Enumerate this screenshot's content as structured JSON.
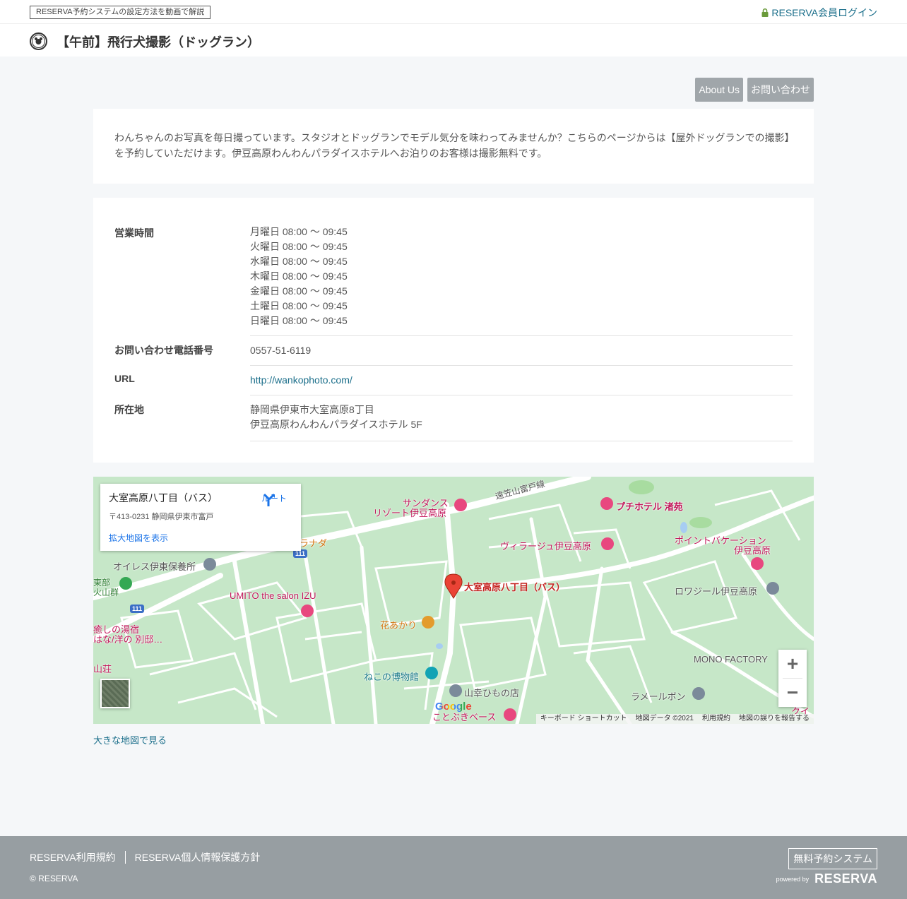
{
  "topbar": {
    "video_link": "RESERVA予約システムの設定方法を動画で解説",
    "login_link": "RESERVA会員ログイン"
  },
  "header": {
    "title": "【午前】飛行犬撮影（ドッグラン）"
  },
  "tabs": [
    {
      "label": "About Us"
    },
    {
      "label": "お問い合わせ"
    }
  ],
  "description": "わんちゃんのお写真を毎日撮っています。スタジオとドッグランでモデル気分を味わってみませんか？こちらのページからは【屋外ドッグランでの撮影】を予約していただけます。伊豆高原わんわんパラダイスホテルへお泊りのお客様は撮影無料です。",
  "info": {
    "hours_label": "営業時間",
    "hours": [
      "月曜日 08:00 ～ 09:45",
      "火曜日 08:00 ～ 09:45",
      "水曜日 08:00 ～ 09:45",
      "木曜日 08:00 ～ 09:45",
      "金曜日 08:00 ～ 09:45",
      "土曜日 08:00 ～ 09:45",
      "日曜日 08:00 ～ 09:45"
    ],
    "phone_label": "お問い合わせ電話番号",
    "phone": "0557-51-6119",
    "url_label": "URL",
    "url": "http://wankophoto.com/",
    "address_label": "所在地",
    "address_line1": "静岡県伊東市大室高原8丁目",
    "address_line2": "伊豆高原わんわんパラダイスホテル 5F"
  },
  "map": {
    "info_title": "大室高原八丁目（バス）",
    "info_address": "〒413-0231 静岡県伊東市富戸",
    "info_link": "拡大地図を表示",
    "route_label": "ルート",
    "labels": {
      "sundance": "サンダンス",
      "sundance2": "リゾート伊豆高原",
      "toasayama": "遠笠山富戸線",
      "petit_hotel": "プチホテル 渚苑",
      "granada": "ラナダ",
      "village": "ヴィラージュ伊豆高原",
      "point_vacation": "ポイントバケーション",
      "point_vacation2": "伊豆高原",
      "oires": "オイレス伊東保養所",
      "higashibu": "東部",
      "kazan": "火山群",
      "pin": "大室高原八丁目（バス）",
      "rowazil": "ロワジール伊豆高原",
      "umito": "UMITO the salon IZU",
      "hanaakari": "花あかり",
      "iyashi": "癒しの湯宿",
      "hana_besso": "はな/洋の 別邸…",
      "sanso": "山荘",
      "mono_factory": "MONO FACTORY",
      "neko": "ねこの博物館",
      "sanko": "山幸ひもの店",
      "lameerbon": "ラメールボン",
      "kotobuki": "ことぶきベース",
      "queen": "クイ",
      "road_111a": "111",
      "road_111b": "111"
    },
    "zoom_in": "+",
    "zoom_out": "−",
    "google": "Google",
    "footer": [
      "キーボード ショートカット",
      "地図データ ©2021",
      "利用規約",
      "地図の誤りを報告する"
    ],
    "big_map_link": "大きな地図で見る"
  },
  "footer": {
    "terms": "RESERVA利用規約",
    "privacy": "RESERVA個人情報保護方針",
    "copyright": "© RESERVA",
    "free_button": "無料予約システム",
    "powered_by": "powered by",
    "brand": "RESERVA"
  },
  "colors": {
    "link": "#1a6e8a",
    "tab_bg": "#a0a6aa",
    "footer_bg": "#979ea2",
    "map_bg": "#c6e7c8",
    "lock": "#6a9a3a"
  }
}
